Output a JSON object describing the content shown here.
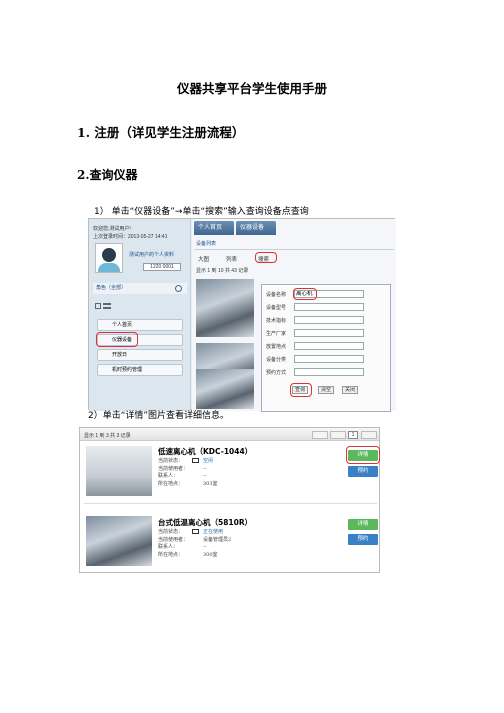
{
  "doc": {
    "title": "仪器共享平台学生使用手册",
    "h1": "1. 注册（详见学生注册流程）",
    "h2": "2.查询仪器",
    "step1": "1）   单击“仪器设备”→单击“搜索”输入查询设备点查询",
    "step2": "2）单击“详情”图片查看详细信息。"
  },
  "shot1": {
    "welcome": "欢迎您,测试用户! ",
    "last_login": "上次登录时间：2013-05-27 14:41",
    "user_link": "测试用户的个人资料",
    "uid": "1220 0001",
    "role": "角色（全部）",
    "menu": [
      "个人首页",
      "仪器设备",
      "开放日",
      "机时预约管理"
    ],
    "tabs": [
      "个人首页",
      "仪器设备"
    ],
    "list_tab": "设备列表",
    "view": [
      "大图",
      "列表"
    ],
    "search_label": "搜索",
    "paging": "显示 1 到 10 共 43 记录",
    "form": {
      "labels": [
        "设备名称",
        "设备型号",
        "技术指标",
        "生产厂家",
        "放置地点",
        "设备分类",
        "预约方式"
      ],
      "name_value": "离心机"
    },
    "buttons": [
      "查询",
      "清空",
      "关闭"
    ]
  },
  "shot2": {
    "paging": "显示 1 到 3 共 3 记录",
    "page_no": "1",
    "items": [
      {
        "name": "低速离心机（KDC-1044）",
        "fields": [
          "当前状态：",
          "当前使用者：",
          "联系人：",
          "所在地点："
        ],
        "values": [
          "空闲",
          "--",
          "--",
          "303室"
        ]
      },
      {
        "name": "台式低温离心机（5810R）",
        "fields": [
          "当前状态：",
          "当前使用者：",
          "联系人：",
          "所在地点："
        ],
        "values": [
          "正在使用",
          "设备管理员2",
          "--",
          "300室"
        ]
      }
    ],
    "detail_label": "详情",
    "book_label": "预约"
  }
}
